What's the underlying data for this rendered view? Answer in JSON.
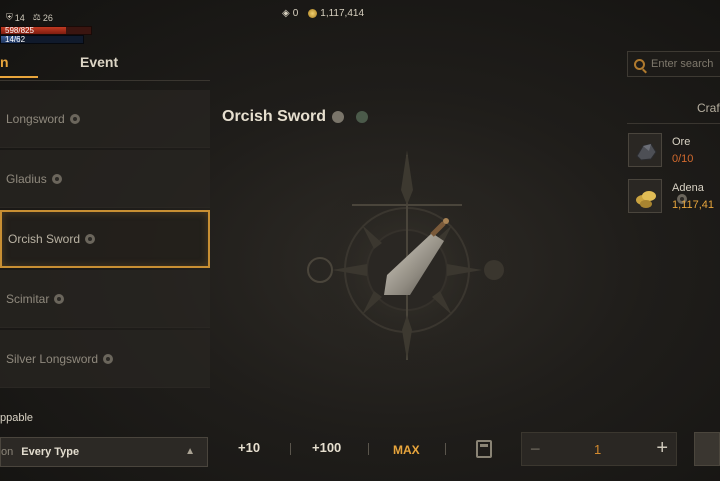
{
  "hud": {
    "stat_a": "14",
    "stat_b": "26",
    "hp_text": "598/825",
    "hp_fraction": 0.72,
    "mp_text": "14/62",
    "mp_fraction": 0.23
  },
  "currency": {
    "gem_value": "0",
    "adena_value": "1,117,414"
  },
  "tabs": [
    {
      "label": "n",
      "active": true
    },
    {
      "label": "Event",
      "active": false
    }
  ],
  "list": {
    "items": [
      {
        "label": "Longsword",
        "selected": false
      },
      {
        "label": "Gladius",
        "selected": false
      },
      {
        "label": "Orcish Sword",
        "selected": true
      },
      {
        "label": "Scimitar",
        "selected": false
      },
      {
        "label": "Silver Longsword",
        "selected": false
      }
    ]
  },
  "filter": {
    "label": "ppable",
    "prefix": "on",
    "value": "Every Type"
  },
  "detail": {
    "title": "Orcish Sword"
  },
  "quantity": {
    "plus10": "+10",
    "plus100": "+100",
    "max": "MAX",
    "value": "1",
    "minus": "−",
    "plus": "+"
  },
  "search": {
    "placeholder": "Enter search"
  },
  "craft": {
    "heading": "Craf",
    "materials": [
      {
        "name": "Ore",
        "count": "0/10",
        "icon": "ore-icon"
      },
      {
        "name": "Adena",
        "count": "1,117,41",
        "icon": "adena-coins-icon"
      }
    ]
  },
  "colors": {
    "accent": "#e8a53c",
    "selection_border": "#c88f33",
    "insufficient": "#d26a2e"
  }
}
